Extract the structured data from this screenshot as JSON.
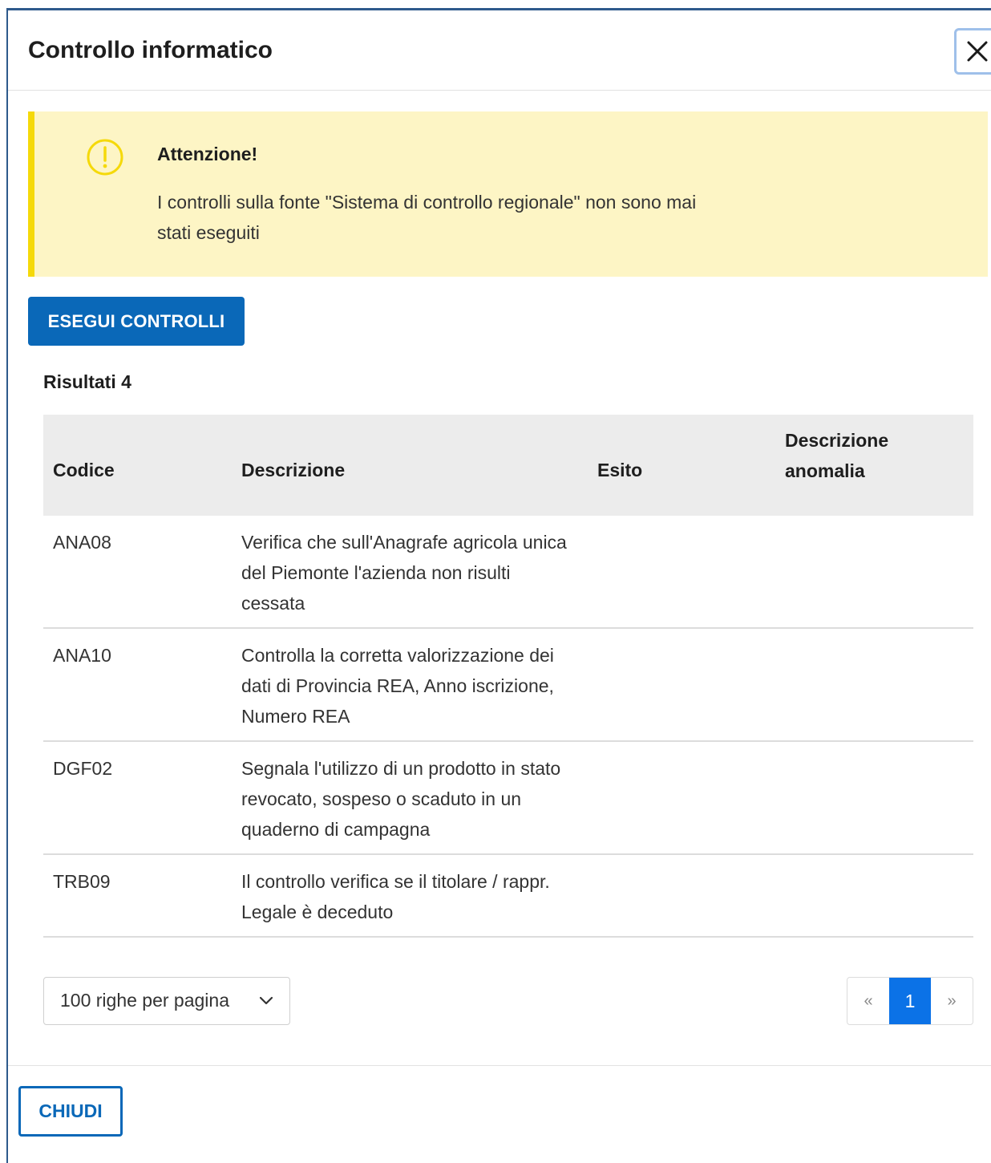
{
  "modal": {
    "title": "Controllo informatico"
  },
  "alert": {
    "title": "Attenzione!",
    "text": "I controlli sulla fonte \"Sistema di controllo regionale\" non sono mai stati eseguiti",
    "color": "#f5d90a"
  },
  "actions": {
    "run_label": "ESEGUI CONTROLLI",
    "close_label": "CHIUDI",
    "accent": "#0a68b8"
  },
  "results": {
    "label": "Risultati 4"
  },
  "table": {
    "headers": {
      "code": "Codice",
      "description": "Descrizione",
      "outcome": "Esito",
      "anomaly_line1": "Descrizione",
      "anomaly_line2": "anomalia"
    },
    "rows": [
      {
        "code": "ANA08",
        "description": "Verifica che sull'Anagrafe agricola unica del Piemonte l'azienda non risulti cessata",
        "outcome": "",
        "anomaly": ""
      },
      {
        "code": "ANA10",
        "description": "Controlla la corretta valorizzazione dei dati di Provincia REA, Anno iscrizione, Numero REA",
        "outcome": "",
        "anomaly": ""
      },
      {
        "code": "DGF02",
        "description": "Segnala l'utilizzo di un prodotto in stato revocato, sospeso o scaduto in un quaderno di campagna",
        "outcome": "",
        "anomaly": ""
      },
      {
        "code": "TRB09",
        "description": "Il controllo verifica se il titolare / rappr. Legale è deceduto",
        "outcome": "",
        "anomaly": ""
      }
    ]
  },
  "pager": {
    "rows_per_page": "100 righe per pagina",
    "prev": "«",
    "current_page": "1",
    "next": "»"
  }
}
